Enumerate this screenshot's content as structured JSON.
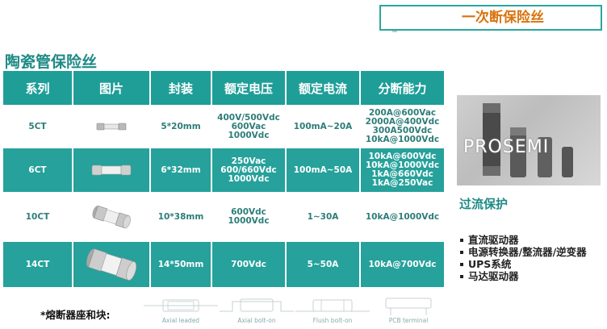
{
  "header": {
    "title": "一次断保险丝",
    "accent": "#2aa6a0",
    "title_color": "#d9730d"
  },
  "section_title": "陶瓷管保险丝",
  "table": {
    "columns": [
      "系列",
      "图片",
      "封装",
      "额定电压",
      "额定电流",
      "分断能力"
    ],
    "rows": [
      {
        "series": "5CT",
        "image": "fuse-5x20-icon",
        "package": "5*20mm",
        "voltage": [
          "400V/500Vdc",
          "600Vac",
          "1000Vdc"
        ],
        "current": "100mA~20A",
        "breaking": [
          "200A@600Vac",
          "2000A@400Vdc",
          "300A500Vdc",
          "10kA@1000Vdc"
        ]
      },
      {
        "series": "6CT",
        "image": "fuse-6x32-icon",
        "package": "6*32mm",
        "voltage": [
          "250Vac",
          "600/660Vdc",
          "1000Vdc"
        ],
        "current": "100mA~50A",
        "breaking": [
          "10kA@600Vdc",
          "10kA@1000Vdc",
          "1kA@660Vdc",
          "1kA@250Vac"
        ]
      },
      {
        "series": "10CT",
        "image": "fuse-10x38-icon",
        "package": "10*38mm",
        "voltage": [
          "600Vdc",
          "1000Vdc"
        ],
        "current": "1~30A",
        "breaking": [
          "10kA@1000Vdc"
        ]
      },
      {
        "series": "14CT",
        "image": "fuse-14x50-icon",
        "package": "14*50mm",
        "voltage": [
          "700Vdc"
        ],
        "current": "5~50A",
        "breaking": [
          "10kA@700Vdc"
        ]
      }
    ],
    "header_color": "#1f9e98",
    "alt_row_color": "#26a19b"
  },
  "photo": {
    "label": "PROSEMI"
  },
  "overcurrent": {
    "title": "过流保护",
    "applications": [
      "直流驱动器",
      "电源转换器/整流器/逆变器",
      "UPS系统",
      "马达驱动器"
    ]
  },
  "footer": {
    "label": "*熔断器座和块:",
    "mounts": [
      "Axial leaded",
      "Axial bolt-on",
      "Flush bolt-on",
      "PCB terminal"
    ]
  }
}
